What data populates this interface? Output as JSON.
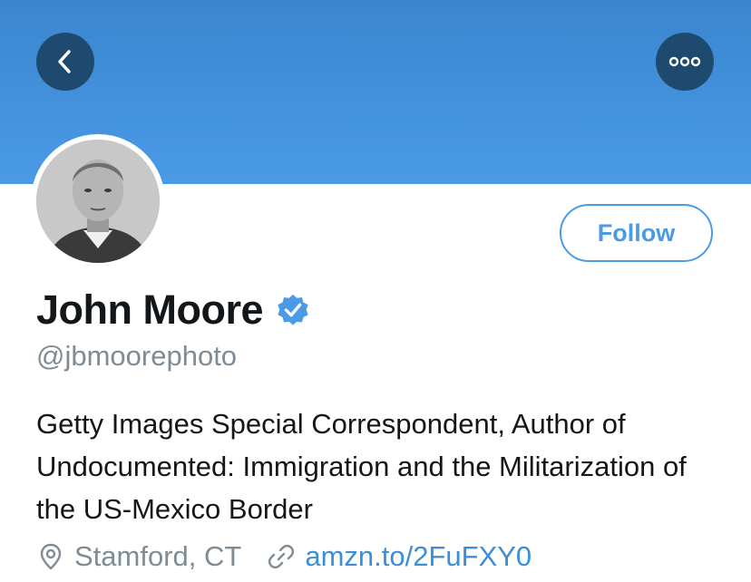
{
  "header": {
    "banner_color": "#4a9ae6",
    "back_icon": "chevron-left-icon",
    "more_icon": "ellipsis-icon"
  },
  "profile": {
    "name": "John Moore",
    "verified": true,
    "verified_icon": "verified-badge-icon",
    "handle": "@jbmoorephoto",
    "bio": "Getty Images Special Correspondent, Author of Undocumented: Immigration and the Militarization of the US-Mexico Border",
    "location": "Stamford, CT",
    "location_icon": "location-pin-icon",
    "link": "amzn.to/2FuFXY0",
    "link_icon": "link-icon"
  },
  "actions": {
    "follow_label": "Follow"
  },
  "colors": {
    "accent": "#4a9ae6",
    "text_primary": "#14171a",
    "text_secondary": "#7f8b95",
    "button_dark": "#1f4a6f"
  }
}
